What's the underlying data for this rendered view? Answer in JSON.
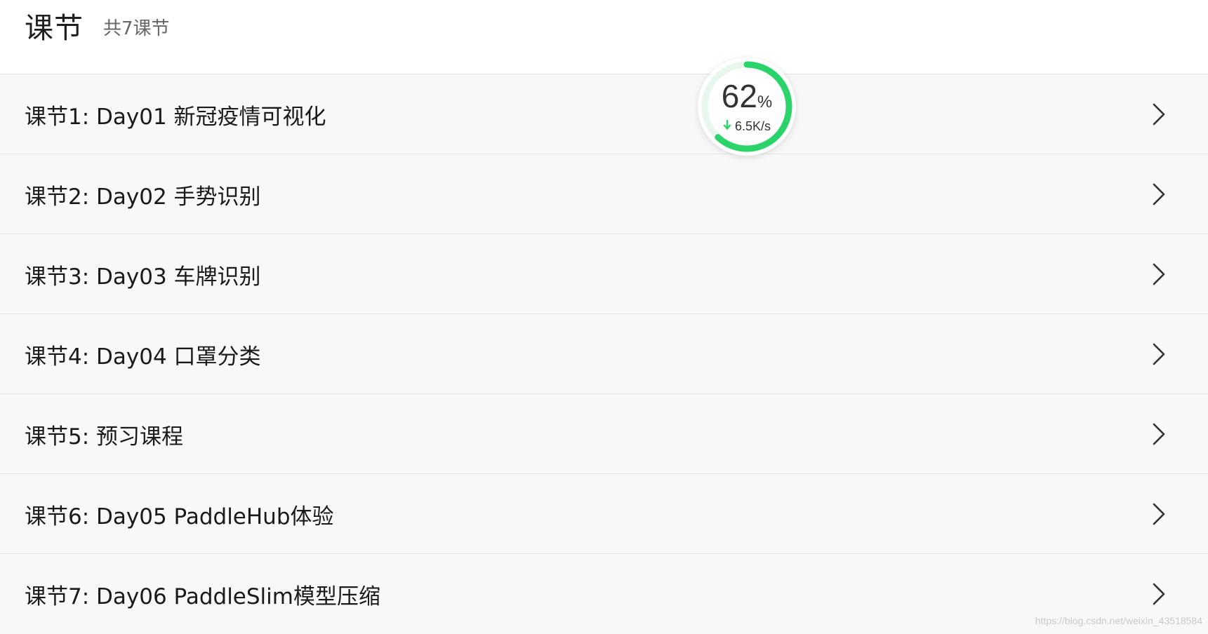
{
  "header": {
    "title": "课节",
    "count": "共7课节"
  },
  "lessons": [
    {
      "label": "课节1: Day01 新冠疫情可视化"
    },
    {
      "label": "课节2: Day02 手势识别"
    },
    {
      "label": "课节3: Day03 车牌识别"
    },
    {
      "label": "课节4: Day04 口罩分类"
    },
    {
      "label": "课节5: 预习课程"
    },
    {
      "label": "课节6: Day05 PaddleHub体验"
    },
    {
      "label": "课节7: Day06 PaddleSlim模型压缩"
    }
  ],
  "progress_widget": {
    "percent": 62,
    "percent_text": "62",
    "percent_symbol": "%",
    "speed": "6.5K/s",
    "accent_color": "#2bd36b",
    "track_color": "#e8f7ee"
  },
  "watermark": "https://blog.csdn.net/weixin_43518584",
  "icons": {
    "row_arrow": "chevron-right-icon",
    "download": "arrow-down-icon"
  }
}
